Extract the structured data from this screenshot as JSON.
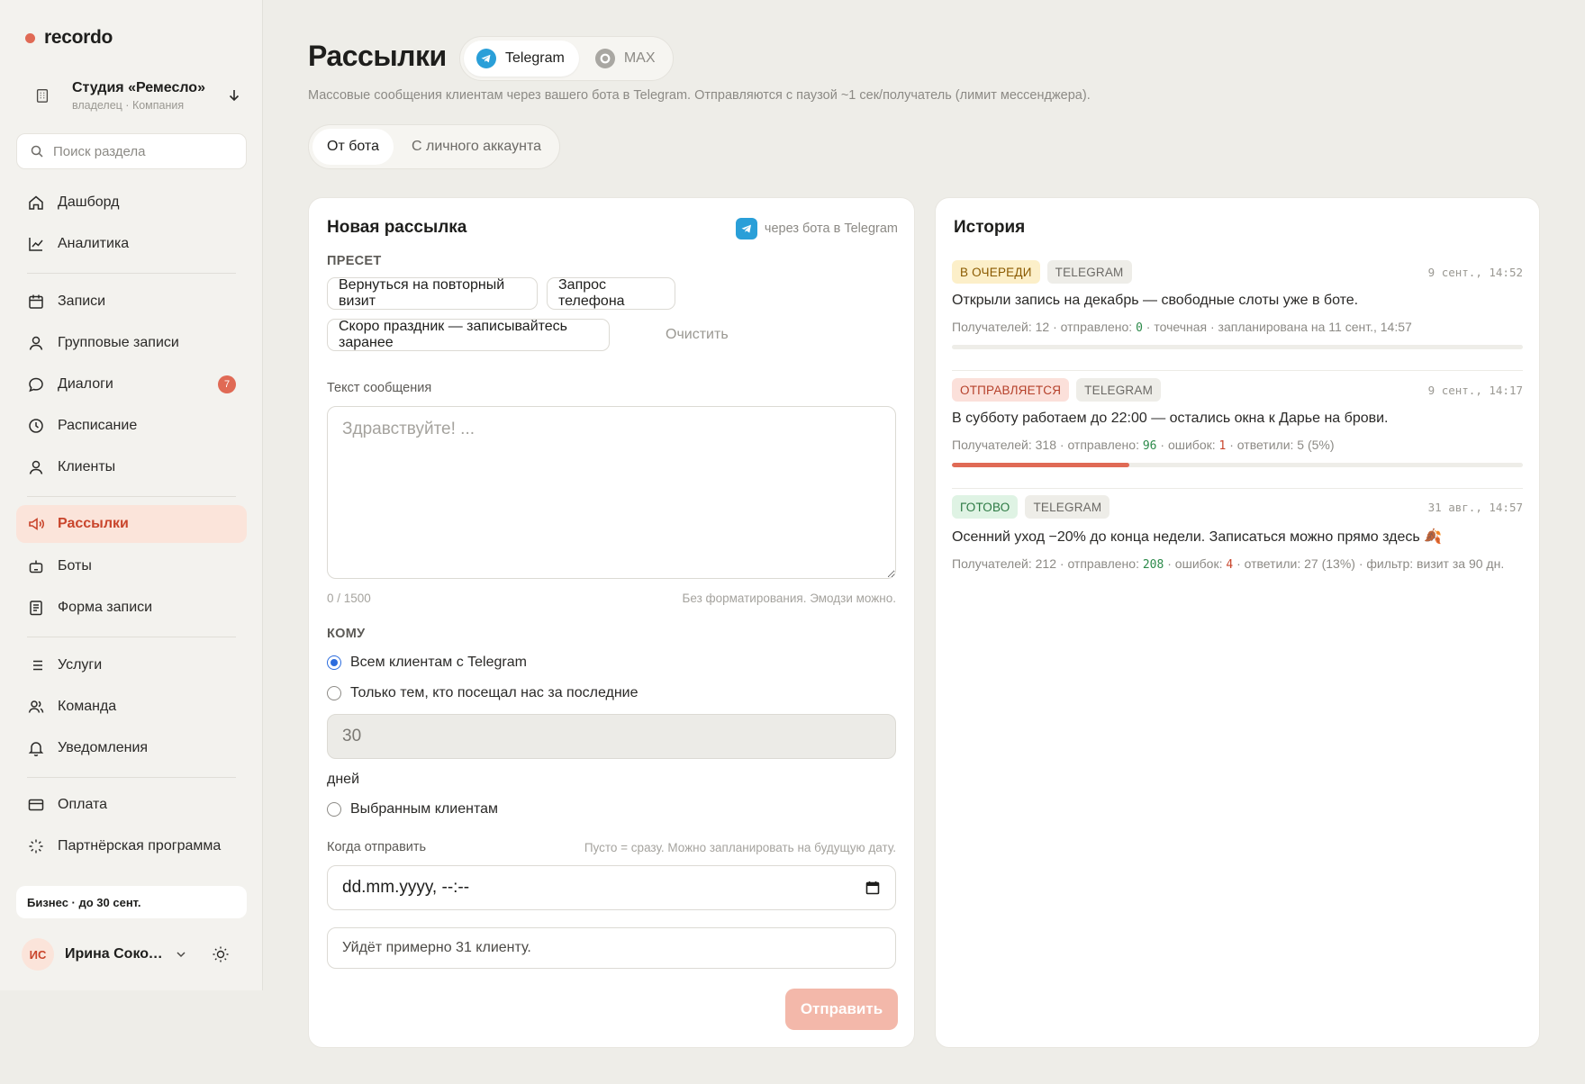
{
  "app": {
    "logo": "recordo"
  },
  "workspace": {
    "name": "Студия «Ремесло»",
    "role": "владелец · Компания"
  },
  "sidebar": {
    "search_placeholder": "Поиск раздела",
    "items": [
      {
        "label": "Дашборд",
        "icon": "home-icon"
      },
      {
        "label": "Аналитика",
        "icon": "chart-icon"
      },
      {
        "label": "Записи",
        "icon": "calendar-icon"
      },
      {
        "label": "Групповые записи",
        "icon": "user-icon"
      },
      {
        "label": "Диалоги",
        "icon": "chat-icon",
        "badge": "7"
      },
      {
        "label": "Расписание",
        "icon": "clock-icon"
      },
      {
        "label": "Клиенты",
        "icon": "user-icon"
      },
      {
        "label": "Рассылки",
        "icon": "megaphone-icon",
        "active": true
      },
      {
        "label": "Боты",
        "icon": "bot-icon"
      },
      {
        "label": "Форма записи",
        "icon": "form-icon"
      },
      {
        "label": "Услуги",
        "icon": "list-icon"
      },
      {
        "label": "Команда",
        "icon": "team-icon"
      },
      {
        "label": "Уведомления",
        "icon": "bell-icon"
      },
      {
        "label": "Оплата",
        "icon": "card-icon"
      },
      {
        "label": "Партнёрская программа",
        "icon": "sparkle-icon"
      }
    ],
    "plan": "Бизнес · до 30 сент.",
    "user": {
      "initials": "ИС",
      "name": "Ирина Соколова"
    }
  },
  "header": {
    "title": "Рассылки",
    "channels": [
      {
        "label": "Telegram",
        "active": true
      },
      {
        "label": "MAX",
        "active": false
      }
    ],
    "subtitle": "Массовые сообщения клиентам через вашего бота в Telegram. Отправляются с паузой ~1 сек/получатель (лимит мессенджера).",
    "modes": [
      {
        "label": "От бота",
        "active": true
      },
      {
        "label": "С личного аккаунта",
        "active": false
      }
    ]
  },
  "form": {
    "title": "Новая рассылка",
    "via": "через бота в Telegram",
    "preset_label": "ПРЕСЕТ",
    "presets": [
      "Вернуться на повторный визит",
      "Запрос телефона",
      "Скоро праздник — записывайтесь заранее"
    ],
    "clear": "Очистить",
    "message_label": "Текст сообщения",
    "message_placeholder": "Здравствуйте! ...",
    "message_value": "",
    "counter": "0 / 1500",
    "format_hint": "Без форматирования. Эмодзи можно.",
    "to_label": "КОМУ",
    "to_options": [
      "Всем клиентам с Telegram",
      "Только тем, кто посещал нас за последние",
      "Выбранным клиентам"
    ],
    "days_value": "30",
    "days_label": "дней",
    "when_label": "Когда отправить",
    "when_hint": "Пусто = сразу. Можно запланировать на будущую дату.",
    "date_placeholder": "dd.mm.yyyy, --:--",
    "estimate": "Уйдёт примерно 31 клиенту.",
    "send": "Отправить",
    "colors": {
      "accent": "#e06a55",
      "send_disabled": "#f3b8aa",
      "telegram": "#2a9fd8"
    }
  },
  "history": {
    "title": "История",
    "items": [
      {
        "status": "В ОЧЕРЕДИ",
        "status_kind": "queue",
        "channel": "TELEGRAM",
        "time": "9 сент., 14:52",
        "message": "Открыли запись на декабрь — свободные слоты уже в боте.",
        "recipients_label": "Получателей:",
        "recipients": "12",
        "sent_label": "отправлено:",
        "sent": "0",
        "tail": "· точечная · запланирована на 11 сент., 14:57",
        "progress": 0
      },
      {
        "status": "ОТПРАВЛЯЕТСЯ",
        "status_kind": "sending",
        "channel": "TELEGRAM",
        "time": "9 сент., 14:17",
        "message": "В субботу работаем до 22:00 — остались окна к Дарье на брови.",
        "recipients_label": "Получателей:",
        "recipients": "318",
        "sent_label": "отправлено:",
        "sent": "96",
        "errors_label": "ошибок:",
        "errors": "1",
        "tail": "· ответили: 5 (5%)",
        "progress": 0.31
      },
      {
        "status": "ГОТОВО",
        "status_kind": "done",
        "channel": "TELEGRAM",
        "time": "31 авг., 14:57",
        "message": "Осенний уход −20% до конца недели. Записаться можно прямо здесь 🍂",
        "recipients_label": "Получателей:",
        "recipients": "212",
        "sent_label": "отправлено:",
        "sent": "208",
        "errors_label": "ошибок:",
        "errors": "4",
        "tail": "· ответили: 27 (13%) · фильтр: визит за 90 дн."
      }
    ]
  }
}
